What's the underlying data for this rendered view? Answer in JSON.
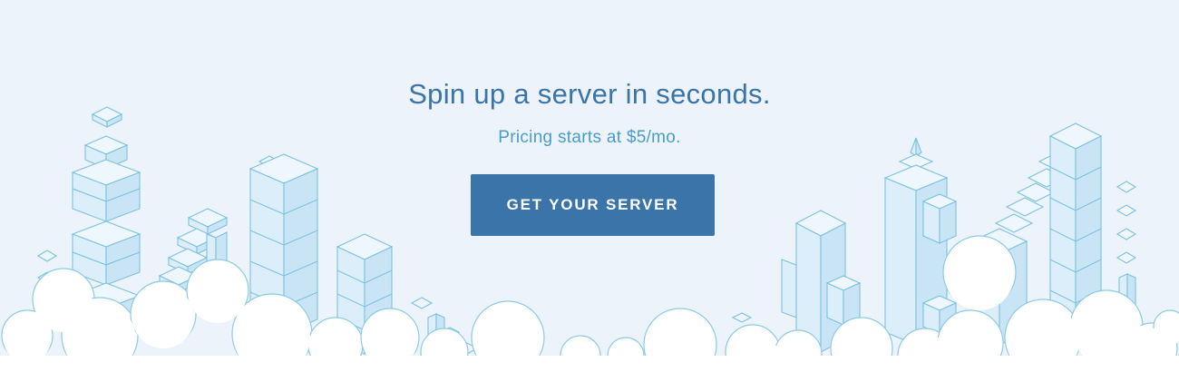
{
  "hero": {
    "headline": "Spin up a server in seconds.",
    "subline": "Pricing starts at $5/mo.",
    "cta_label": "GET YOUR SERVER"
  },
  "colors": {
    "background": "#ecf3fb",
    "headline": "#3a74a8",
    "subline": "#4a9ccd",
    "button": "#3a74a8",
    "illustration_stroke": "#7cc1e0"
  }
}
